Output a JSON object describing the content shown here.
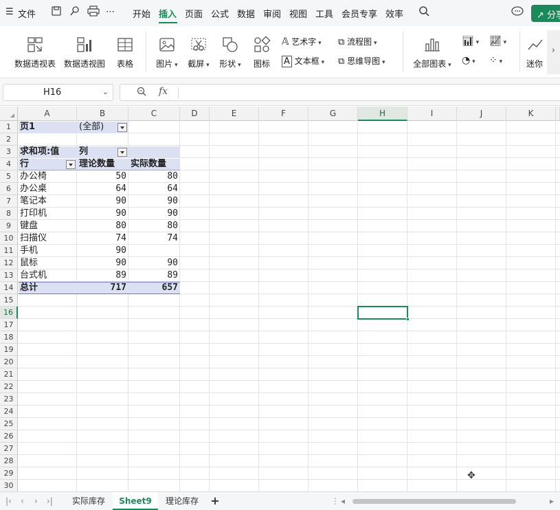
{
  "menubar": {
    "menu_icon": "hamburger-icon",
    "file_label": "文件",
    "tabs": [
      "开始",
      "插入",
      "页面",
      "公式",
      "数据",
      "审阅",
      "视图",
      "工具",
      "会员专享",
      "效率"
    ],
    "active_tab": "插入",
    "share_label": "分享"
  },
  "ribbon": {
    "pivot_table": "数据透视表",
    "pivot_chart": "数据透视图",
    "table": "表格",
    "picture": "图片",
    "screenshot": "截屏",
    "shape": "形状",
    "icon": "图标",
    "word_art": "艺术字",
    "text_box": "文本框",
    "flowchart": "流程图",
    "mind_map": "思维导图",
    "all_charts": "全部图表",
    "sparkline": "迷你"
  },
  "formula_bar": {
    "name_box": "H16",
    "fx_label": "fx",
    "formula": ""
  },
  "grid": {
    "columns": [
      "A",
      "B",
      "C",
      "D",
      "E",
      "F",
      "G",
      "H",
      "I",
      "J",
      "K"
    ],
    "selected_column": "H",
    "rows": [
      "1",
      "2",
      "3",
      "4",
      "5",
      "6",
      "7",
      "8",
      "9",
      "10",
      "11",
      "12",
      "13",
      "14",
      "15",
      "16",
      "17",
      "18",
      "19",
      "20",
      "21",
      "22",
      "23",
      "24",
      "25",
      "26",
      "27",
      "28",
      "29",
      "30"
    ],
    "selected_row": "16",
    "selected_cell": "H16"
  },
  "pivot": {
    "page_field": "页1",
    "page_value": "(全部)",
    "values_label": "求和项:值",
    "column_label": "列",
    "row_label": "行",
    "headers": [
      "理论数量",
      "实际数量"
    ],
    "rows": [
      {
        "name": "办公椅",
        "theory": "50",
        "actual": "80"
      },
      {
        "name": "办公桌",
        "theory": "64",
        "actual": "64"
      },
      {
        "name": "笔记本",
        "theory": "90",
        "actual": "90"
      },
      {
        "name": "打印机",
        "theory": "90",
        "actual": "90"
      },
      {
        "name": "键盘",
        "theory": "80",
        "actual": "80"
      },
      {
        "name": "扫描仪",
        "theory": "74",
        "actual": "74"
      },
      {
        "name": "手机",
        "theory": "90",
        "actual": ""
      },
      {
        "name": "鼠标",
        "theory": "90",
        "actual": "90"
      },
      {
        "name": "台式机",
        "theory": "89",
        "actual": "89"
      }
    ],
    "total_label": "总计",
    "total_theory": "717",
    "total_actual": "657"
  },
  "sheet_tabs": [
    "实际库存",
    "Sheet9",
    "理论库存"
  ],
  "active_sheet": "Sheet9",
  "add_sheet_label": "+"
}
